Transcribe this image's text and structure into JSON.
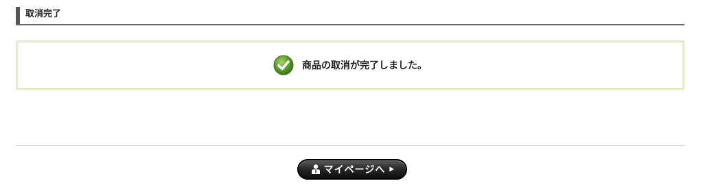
{
  "heading": {
    "title": "取消完了"
  },
  "message": {
    "icon": "check-circle-icon",
    "text": "商品の取消が完了しました。",
    "border_color": "#e3ecc2",
    "icon_color": "#5a9a2a"
  },
  "actions": {
    "mypage_label": "マイページへ",
    "mypage_icon": "user-icon",
    "arrow_icon": "triangle-right-icon"
  }
}
